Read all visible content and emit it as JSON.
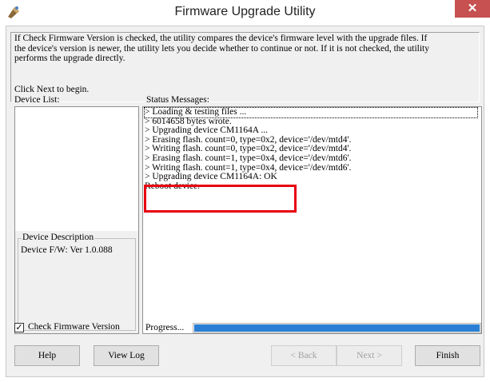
{
  "window": {
    "title": "Firmware Upgrade Utility",
    "close_glyph": "✕"
  },
  "intro": {
    "text": "If Check Firmware Version is checked, the utility compares the device's firmware level with the upgrade files. If the device's version is newer, the utility lets you decide whether to continue or not. If it is not checked, the utility performs the upgrade directly.",
    "click_next": "Click Next to begin."
  },
  "device_list": {
    "label": "Device List:"
  },
  "device_description": {
    "legend": "Device Description",
    "value": "Device F/W: Ver 1.0.088"
  },
  "status": {
    "label": "Status Messages:",
    "lines": [
      "> Loading & testing files ...",
      "> 6014658 bytes wrote.",
      "> Upgrading device CM1164A ...",
      "> Erasing flash. count=0, type=0x2, device='/dev/mtd4'.",
      "> Writing flash. count=0, type=0x2, device='/dev/mtd4'.",
      "> Erasing flash. count=1, type=0x4, device='/dev/mtd6'.",
      "> Writing flash. count=1, type=0x4, device='/dev/mtd6'.",
      "> Upgrading device CM1164A: OK",
      "Reboot device."
    ]
  },
  "check_firmware": {
    "label": "Check Firmware Version",
    "checked": true,
    "mark": "✓"
  },
  "progress": {
    "label": "Progress...",
    "fraction": 1.0,
    "color": "#2a7fd4"
  },
  "buttons": {
    "help": "Help",
    "view_log": "View Log",
    "back": "< Back",
    "next": "Next >",
    "finish": "Finish"
  },
  "icons": {
    "app": "upgrade-wizard-icon"
  }
}
